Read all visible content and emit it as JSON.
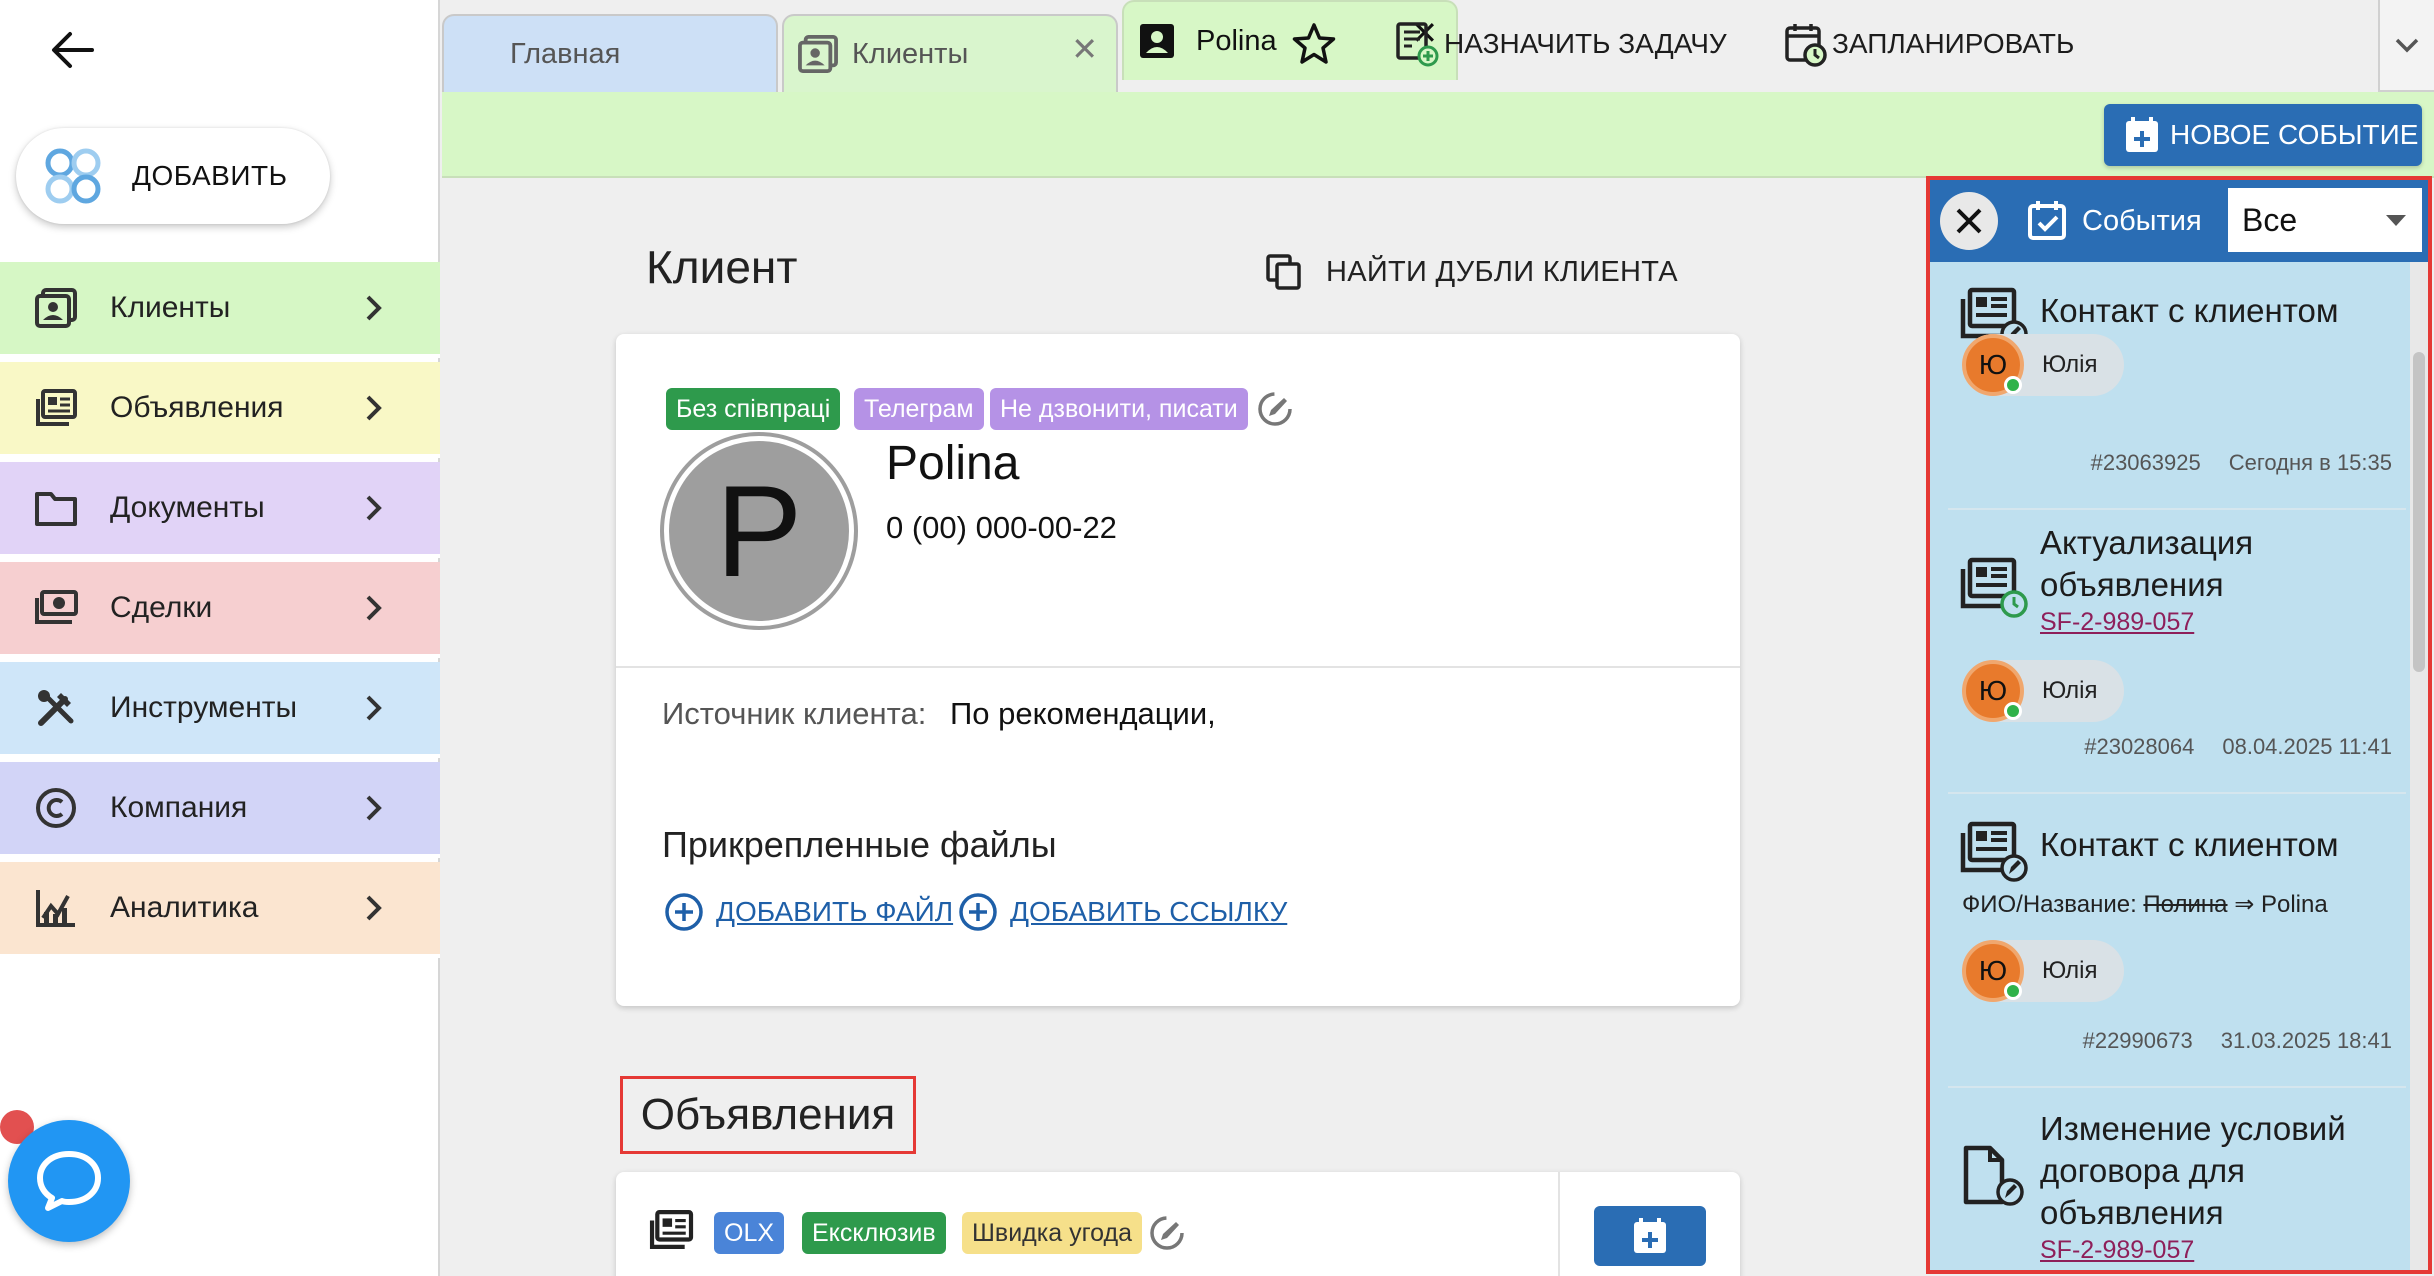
{
  "sidebar": {
    "add_label": "ДОБАВИТЬ",
    "items": [
      {
        "label": "Клиенты",
        "icon": "clients-icon",
        "color": "#d6f7c5"
      },
      {
        "label": "Объявления",
        "icon": "listings-icon",
        "color": "#f9f8c6"
      },
      {
        "label": "Документы",
        "icon": "folder-icon",
        "color": "#e1d3f7"
      },
      {
        "label": "Сделки",
        "icon": "money-icon",
        "color": "#f6cfd0"
      },
      {
        "label": "Инструменты",
        "icon": "tools-icon",
        "color": "#cfe6f9"
      },
      {
        "label": "Компания",
        "icon": "copyright-icon",
        "color": "#d2d4f7"
      },
      {
        "label": "Аналитика",
        "icon": "analytics-icon",
        "color": "#fbe5d0"
      }
    ]
  },
  "tabs": [
    {
      "label": "Главная"
    },
    {
      "label": "Клиенты"
    },
    {
      "label": "Polina"
    }
  ],
  "toolbar": {
    "assign_task": "НАЗНАЧИТЬ ЗАДАЧУ",
    "schedule": "ЗАПЛАНИРОВАТЬ",
    "new_event": "НОВОЕ СОБЫТИЕ"
  },
  "client": {
    "section_title": "Клиент",
    "find_duplicates": "НАЙТИ ДУБЛИ КЛИЕНТА",
    "tags": [
      {
        "label": "Без співпраці",
        "color": "#2e9a4c"
      },
      {
        "label": "Телеграм",
        "color": "#b592e6"
      },
      {
        "label": "Не дзвонити, писати",
        "color": "#b592e6"
      }
    ],
    "avatar_letter": "P",
    "name": "Polina",
    "phone": "0 (00) 000-00-22",
    "source_label": "Источник клиента:",
    "source_value": "По рекомендации,",
    "files_title": "Прикрепленные файлы",
    "add_file": "ДОБАВИТЬ ФАЙЛ",
    "add_link": "ДОБАВИТЬ ССЫЛКУ"
  },
  "listings": {
    "section_title": "Объявления",
    "tags": [
      {
        "label": "OLX",
        "color": "#4a84d8"
      },
      {
        "label": "Ексклюзив",
        "color": "#2e9a4c"
      },
      {
        "label": "Швидка угода",
        "color": "#f6e08a"
      }
    ]
  },
  "events": {
    "title": "События",
    "filter_value": "Все",
    "items": [
      {
        "title": "Контакт с клиентом",
        "user_initial": "Ю",
        "user_name": "Юлія",
        "id": "#23063925",
        "time": "Сегодня в 15:35"
      },
      {
        "title_line1": "Актуализация",
        "title_line2": "объявления",
        "link": "SF-2-989-057",
        "user_initial": "Ю",
        "user_name": "Юлія",
        "id": "#23028064",
        "time": "08.04.2025 11:41"
      },
      {
        "title": "Контакт с клиентом",
        "change_label": "ФИО/Название:",
        "change_old": "Полина",
        "change_arrow": "⇒",
        "change_new": "Polina",
        "user_initial": "Ю",
        "user_name": "Юлія",
        "id": "#22990673",
        "time": "31.03.2025 18:41"
      },
      {
        "title_line1": "Изменение условий",
        "title_line2": "договора для",
        "title_line3": "объявления",
        "link": "SF-2-989-057"
      }
    ]
  }
}
